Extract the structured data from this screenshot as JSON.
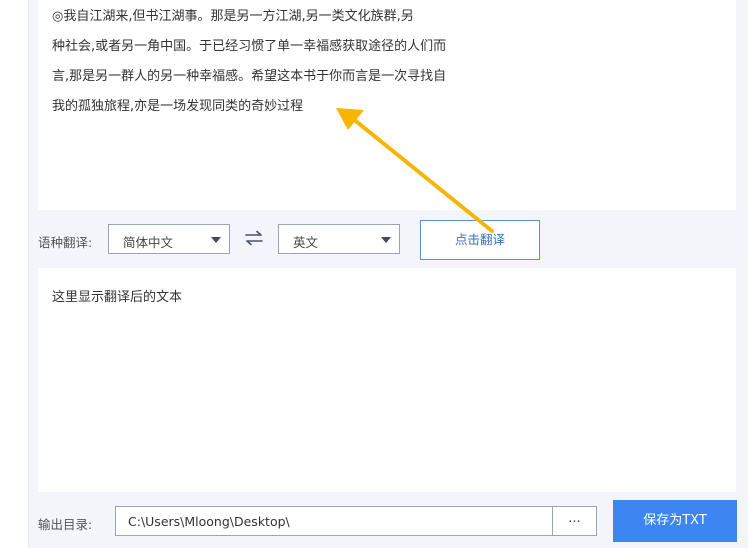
{
  "source": {
    "lines": [
      "◎我自江湖来,但书江湖事。那是另一方江湖,另一类文化族群,另",
      "种社会,或者另一角中国。于已经习惯了单一幸福感获取途径的人们而",
      "言,那是另一群人的另一种幸福感。希望这本书于你而言是一次寻找自",
      "我的孤独旅程,亦是一场发现同类的奇妙过程"
    ]
  },
  "toolbar": {
    "language_label": "语种翻译:",
    "source_language": "简体中文",
    "target_language": "英文",
    "translate_button": "点击翻译"
  },
  "output": {
    "placeholder": "这里显示翻译后的文本"
  },
  "footer": {
    "output_dir_label": "输出目录:",
    "output_dir_value": "C:\\Users\\Mloong\\Desktop\\",
    "browse_button": "...",
    "save_button": "保存为TXT"
  },
  "colors": {
    "accent": "#3d86f2",
    "annotation_arrow": "#f7b500"
  },
  "icons": {
    "swap": "swap-arrows-icon",
    "dropdown": "chevron-down-icon"
  }
}
